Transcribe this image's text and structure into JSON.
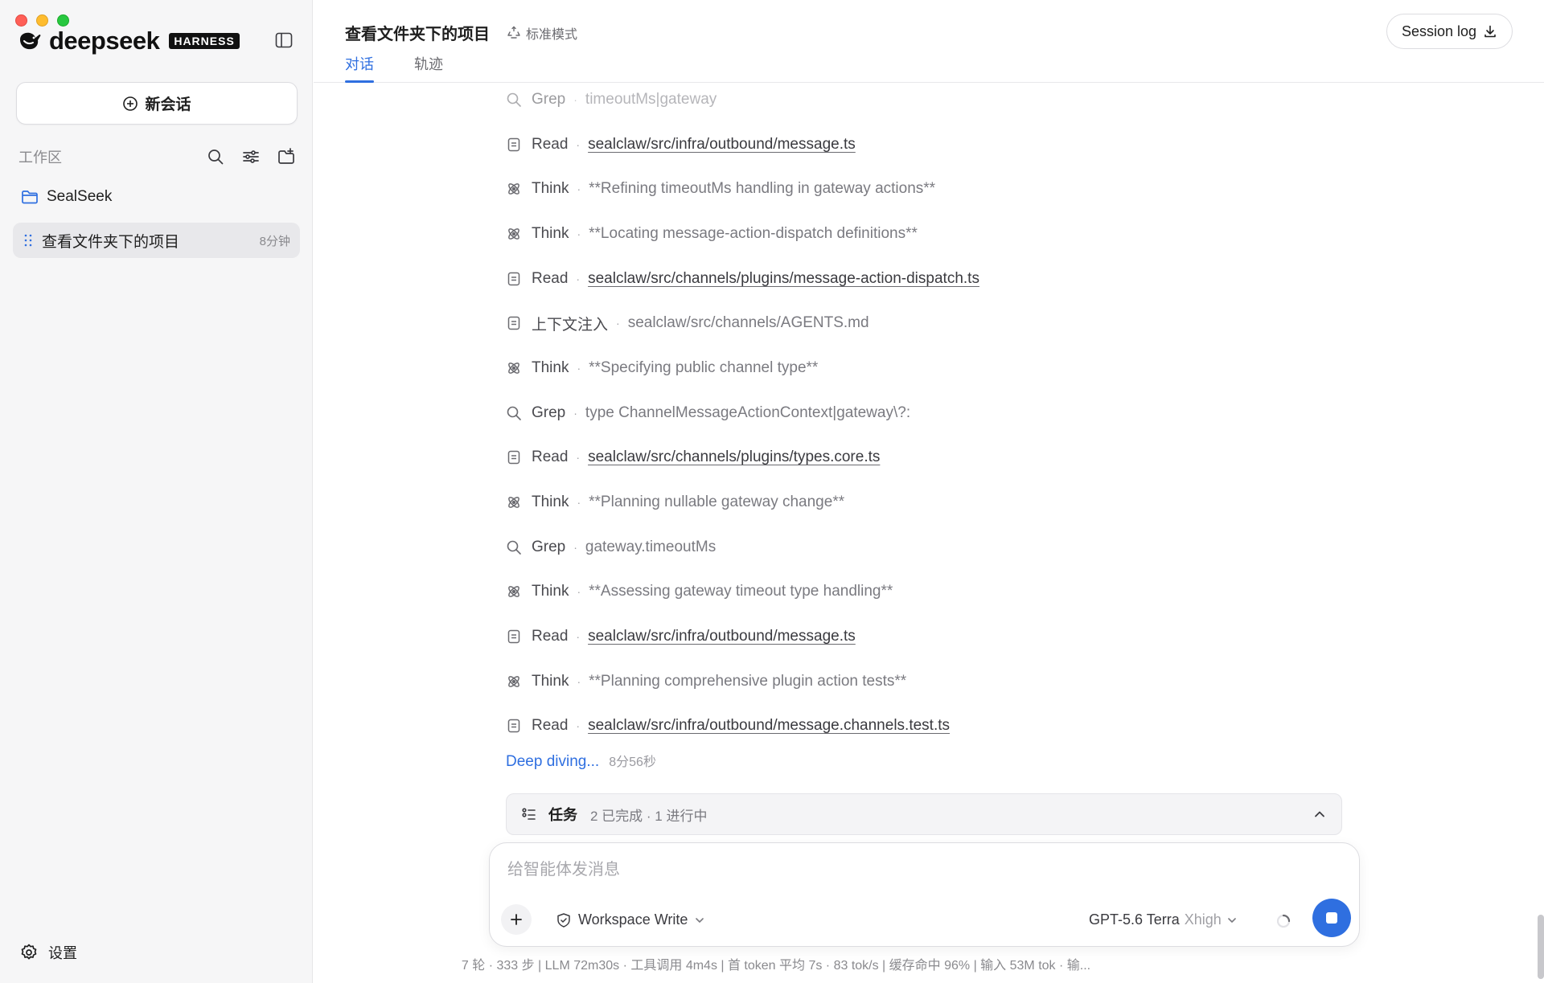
{
  "brand": {
    "name": "deepseek",
    "tag": "HARNESS"
  },
  "sidebar": {
    "new_chat_label": "新会话",
    "workspace_title": "工作区",
    "folder": {
      "name": "SealSeek"
    },
    "session": {
      "name": "查看文件夹下的项目",
      "time": "8分钟"
    },
    "settings_label": "设置"
  },
  "header": {
    "title": "查看文件夹下的项目",
    "mode": "标准模式",
    "tabs": [
      {
        "label": "对话"
      },
      {
        "label": "轨迹"
      }
    ],
    "session_log_label": "Session log"
  },
  "steps": [
    {
      "icon": "search-icon",
      "type": "Grep",
      "detail": "timeoutMs|gateway",
      "link": false
    },
    {
      "icon": "file-icon",
      "type": "Read",
      "detail": "sealclaw/src/infra/outbound/message.ts",
      "link": true
    },
    {
      "icon": "brain-icon",
      "type": "Think",
      "detail": "**Refining timeoutMs handling in gateway actions**",
      "link": false
    },
    {
      "icon": "brain-icon",
      "type": "Think",
      "detail": "**Locating message-action-dispatch definitions**",
      "link": false
    },
    {
      "icon": "file-icon",
      "type": "Read",
      "detail": "sealclaw/src/channels/plugins/message-action-dispatch.ts",
      "link": true
    },
    {
      "icon": "file-icon",
      "type": "上下文注入",
      "detail": "sealclaw/src/channels/AGENTS.md",
      "link": false
    },
    {
      "icon": "brain-icon",
      "type": "Think",
      "detail": "**Specifying public channel type**",
      "link": false
    },
    {
      "icon": "search-icon",
      "type": "Grep",
      "detail": "type ChannelMessageActionContext|gateway\\?:",
      "link": false
    },
    {
      "icon": "file-icon",
      "type": "Read",
      "detail": "sealclaw/src/channels/plugins/types.core.ts",
      "link": true
    },
    {
      "icon": "brain-icon",
      "type": "Think",
      "detail": "**Planning nullable gateway change**",
      "link": false
    },
    {
      "icon": "search-icon",
      "type": "Grep",
      "detail": "gateway.timeoutMs",
      "link": false
    },
    {
      "icon": "brain-icon",
      "type": "Think",
      "detail": "**Assessing gateway timeout type handling**",
      "link": false
    },
    {
      "icon": "file-icon",
      "type": "Read",
      "detail": "sealclaw/src/infra/outbound/message.ts",
      "link": true
    },
    {
      "icon": "brain-icon",
      "type": "Think",
      "detail": "**Planning comprehensive plugin action tests**",
      "link": false
    },
    {
      "icon": "file-icon",
      "type": "Read",
      "detail": "sealclaw/src/infra/outbound/message.channels.test.ts",
      "link": true
    }
  ],
  "status": {
    "text": "Deep diving...",
    "elapsed": "8分56秒"
  },
  "tasks": {
    "label": "任务",
    "status": "2 已完成 · 1 进行中"
  },
  "composer": {
    "placeholder": "给智能体发消息",
    "permission": "Workspace Write",
    "model": "GPT-5.6 Terra",
    "level": "Xhigh"
  },
  "footer": "7 轮 · 333 步   |   LLM 72m30s · 工具调用 4m4s   |   首 token 平均 7s · 83 tok/s   |   缓存命中 96%   |   输入 53M tok · 输...",
  "colors": {
    "accent": "#2f6fe0",
    "sidebar_bg": "#f6f6f7"
  }
}
